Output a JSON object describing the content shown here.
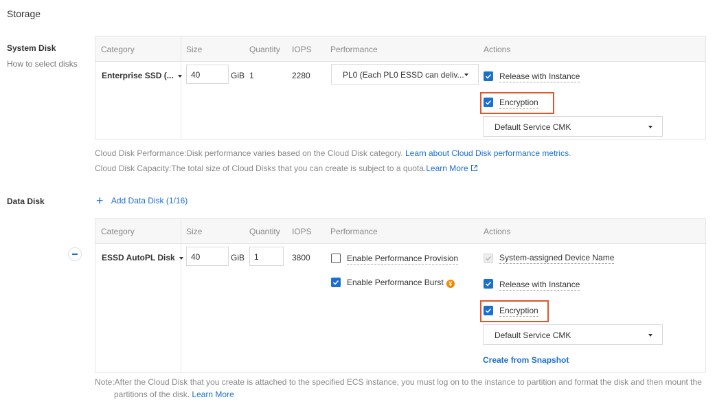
{
  "page": {
    "title": "Storage"
  },
  "system_disk": {
    "label": "System Disk",
    "help_link": "How to select disks",
    "headers": [
      "Category",
      "Size",
      "Quantity",
      "IOPS",
      "Performance",
      "Actions"
    ],
    "category": "Enterprise SSD (...",
    "size": "40",
    "size_unit": "GiB",
    "quantity": "1",
    "iops": "2280",
    "performance": "PL0 (Each PL0 ESSD can deliv...",
    "release_with_instance": "Release with Instance",
    "encryption": "Encryption",
    "kms_key": "Default Service CMK",
    "notes": {
      "performance_prefix": "Cloud Disk Performance:Disk performance varies based on the Cloud Disk category.",
      "performance_link": "Learn about Cloud Disk performance metrics",
      "performance_suffix": ".",
      "capacity_prefix": "Cloud Disk Capacity:The total size of Cloud Disks that you can create is subject to a quota.",
      "capacity_link": "Learn More"
    }
  },
  "data_disk": {
    "label": "Data Disk",
    "add_button": "Add Data Disk (1/16)",
    "headers": [
      "Category",
      "Size",
      "Quantity",
      "IOPS",
      "Performance",
      "Actions"
    ],
    "category": "ESSD AutoPL Disk",
    "size": "40",
    "size_unit": "GiB",
    "quantity": "1",
    "iops": "3800",
    "enable_provision": "Enable Performance Provision",
    "enable_burst": "Enable Performance Burst",
    "burst_coin": "¥",
    "system_device_name": "System-assigned Device Name",
    "release_with_instance": "Release with Instance",
    "encryption": "Encryption",
    "kms_key": "Default Service CMK",
    "create_from_snapshot": "Create from Snapshot",
    "note_line1": "Note:After the Cloud Disk that you create is attached to the specified ECS instance, you must log on to the instance to partition and format the disk and then mount the",
    "note_line2": "partitions of the disk.",
    "note_link": "Learn More"
  },
  "colors": {
    "accent": "#1b6fd0",
    "highlight": "#e0552e"
  }
}
